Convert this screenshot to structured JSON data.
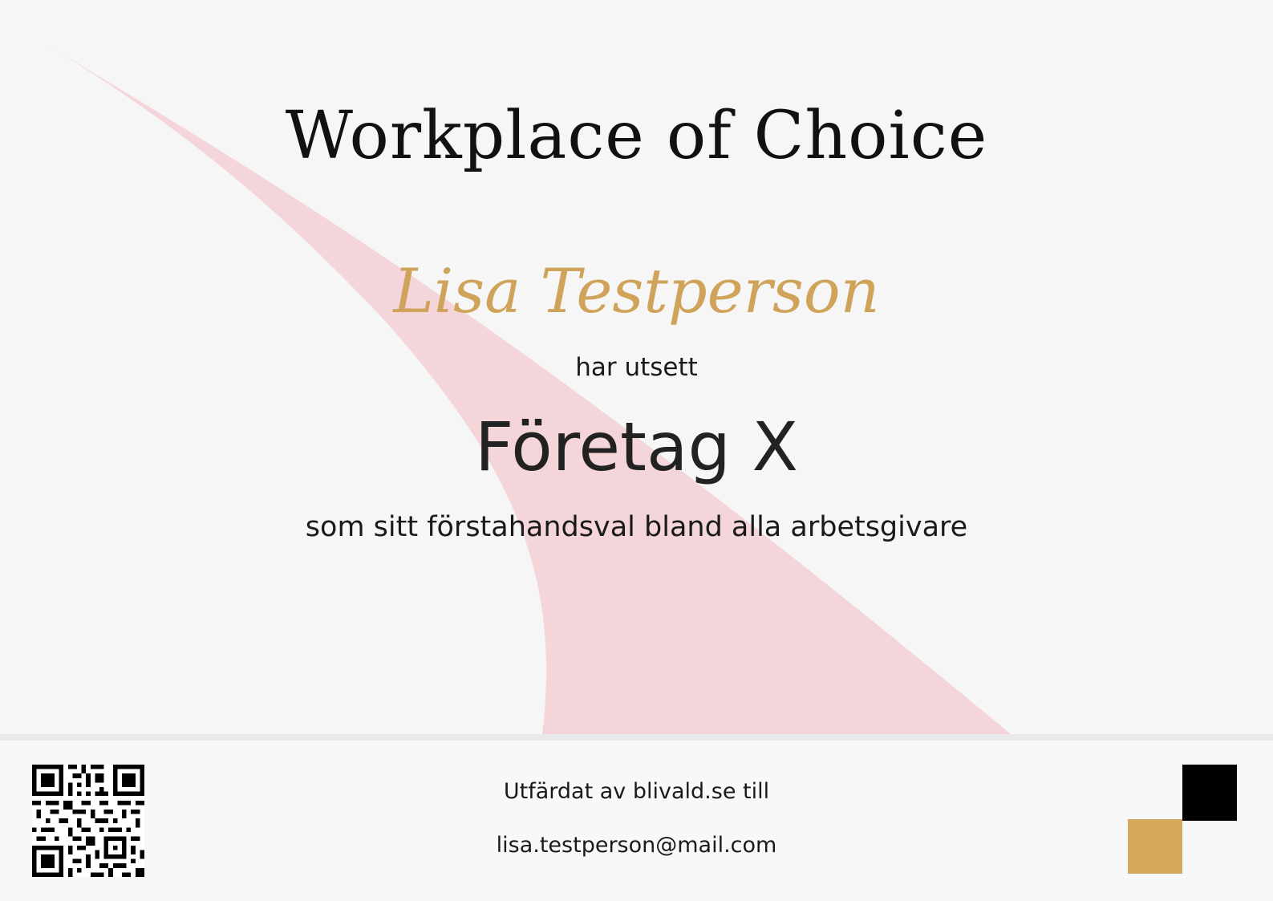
{
  "certificate": {
    "title": "Workplace of Choice",
    "recipient_name": "Lisa Testperson",
    "connector_text": "har utsett",
    "company_name": "Företag X",
    "reason": "som sitt förstahandsval bland alla arbetsgivare"
  },
  "footer": {
    "issued_by": "Utfärdat av blivald.se till",
    "email": "lisa.testperson@mail.com"
  },
  "colors": {
    "accent_gold": "#d6aa5b",
    "name_gold": "#cfa45a",
    "swoosh_pink": "#f4d5d9",
    "text_dark": "#111111"
  },
  "icons": {
    "qr": "qr-code-icon",
    "logo": "blivald-logo-icon"
  }
}
